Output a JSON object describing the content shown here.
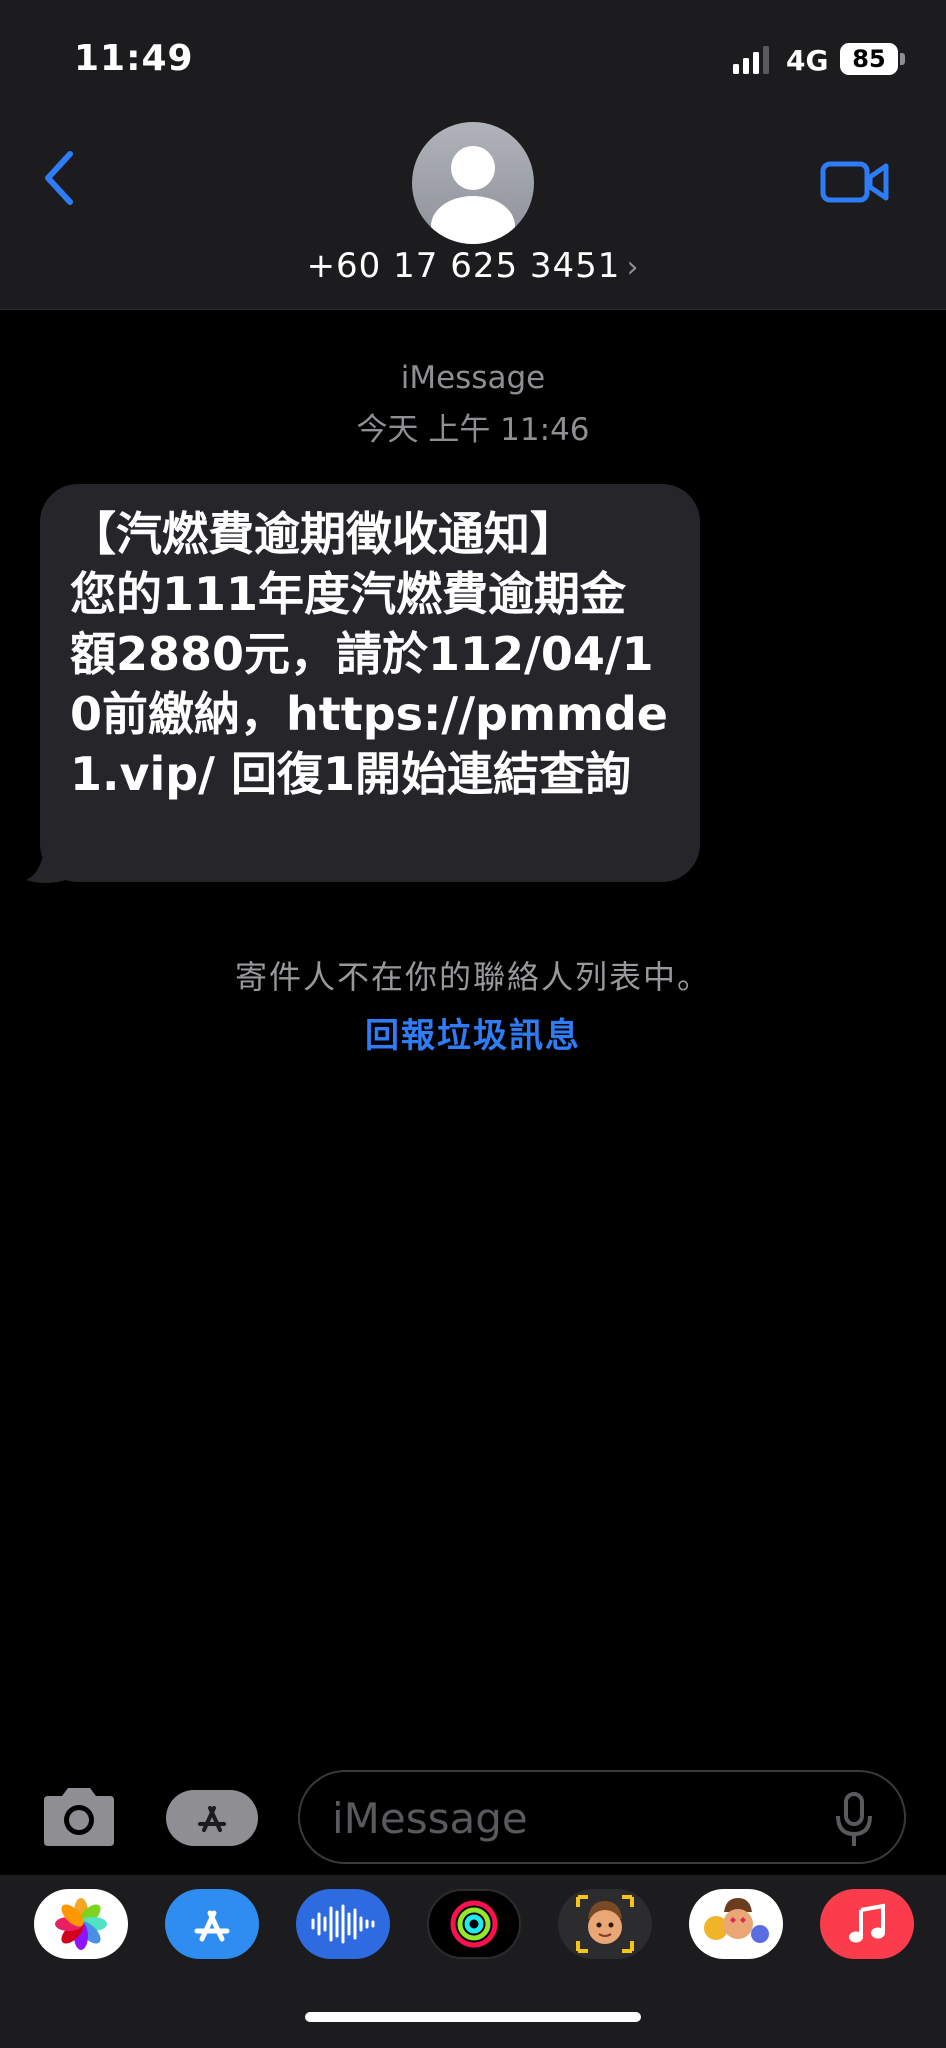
{
  "status_bar": {
    "time": "11:49",
    "network": "4G",
    "battery": "85"
  },
  "header": {
    "contact_number": "+60 17 625 3451",
    "back_icon": "chevron-left-icon",
    "video_icon": "video-camera-icon",
    "accent_color": "#2e7cf6"
  },
  "conversation": {
    "service": "iMessage",
    "timestamp": "今天 上午 11:46",
    "messages": [
      {
        "direction": "incoming",
        "text": "【汽燃費逾期徵收通知】\n您的111年度汽燃費逾期金額2880元，請於112/04/10前繳納，https://pmmde1.vip/ 回復1開始連結查詢"
      }
    ],
    "unknown_sender_notice": "寄件人不在你的聯絡人列表中。",
    "report_junk_label": "回報垃圾訊息"
  },
  "composer": {
    "placeholder": "iMessage",
    "camera_icon": "camera-icon",
    "apps_icon": "app-store-icon",
    "mic_icon": "microphone-icon"
  },
  "app_drawer": {
    "apps": [
      "photos-icon",
      "app-store-icon",
      "audio-message-icon",
      "activity-icon",
      "memoji-icon",
      "memoji-stickers-icon",
      "music-icon"
    ]
  }
}
